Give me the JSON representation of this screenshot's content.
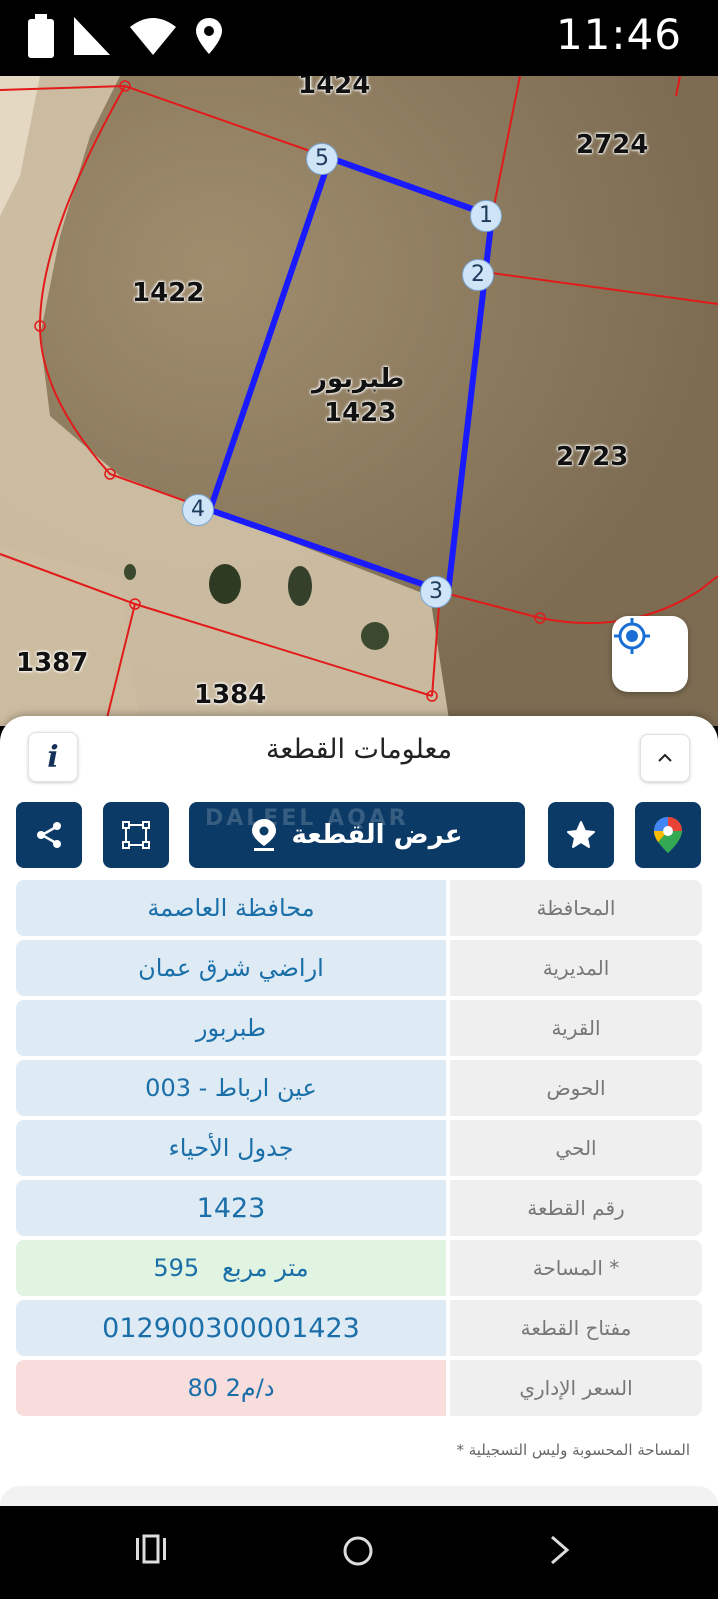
{
  "status": {
    "time": "11:46",
    "icons": [
      "battery-icon",
      "signal-icon",
      "wifi-icon",
      "location-icon"
    ]
  },
  "map": {
    "plots": {
      "top": "1424",
      "left": "1422",
      "right_top": "2724",
      "right": "2723",
      "bottom_left": "1387",
      "bottom": "1384",
      "selected_name": "طبربور",
      "selected_number": "1423"
    },
    "vertices": [
      "1",
      "2",
      "3",
      "4",
      "5"
    ],
    "colors": {
      "parcel_border": "#1a1aff",
      "plot_lines": "#e21a1a"
    }
  },
  "panel": {
    "title": "معلومات القطعة",
    "show_plot_label": "عرض القطعة",
    "watermark": "DALEEL AQAR",
    "rows": [
      {
        "key": "المحافظة",
        "value": "محافظة العاصمة"
      },
      {
        "key": "المديرية",
        "value": "اراضي شرق عمان"
      },
      {
        "key": "القرية",
        "value": "طبربور"
      },
      {
        "key": "الحوض",
        "value": "عين ارباط - 003"
      },
      {
        "key": "الحي",
        "value": "جدول الأحياء"
      },
      {
        "key": "رقم القطعة",
        "value": "1423"
      },
      {
        "key": "المساحة *",
        "value": "595   متر مربع"
      },
      {
        "key": "مفتاح القطعة",
        "value": "012900300001423"
      },
      {
        "key": "السعر الإداري",
        "value": "80 د/م2"
      }
    ],
    "footnote": "* المساحة المحسوبة وليس التسجيلية"
  }
}
